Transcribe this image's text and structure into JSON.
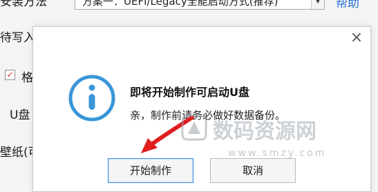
{
  "background_window": {
    "top_label": "安装方法",
    "combo_value": "方案一：UEFI/Legacy全能启动方式(推荐)",
    "help_link": "帮助",
    "write_label": "待写入",
    "checkbox_label": "格",
    "checkbox_mark": "✓",
    "udisk_label": "U盘",
    "wallpaper_label": "壁纸(可"
  },
  "dialog": {
    "close_glyph": "×",
    "title": "即将开始制作可启动U盘",
    "message": "亲，制作前请务必做好数据备份。",
    "icon": "info-icon",
    "buttons": {
      "start": "开始制作",
      "cancel": "取消"
    }
  },
  "watermark": {
    "text": "数码资源网",
    "url": "www.smzy.com"
  },
  "colors": {
    "info_icon": "#3a96d9",
    "primary_border": "#3b8ee0",
    "link": "#2470d8",
    "annotation_arrow": "#e01e1e",
    "watermark": "#9aa4ad"
  }
}
